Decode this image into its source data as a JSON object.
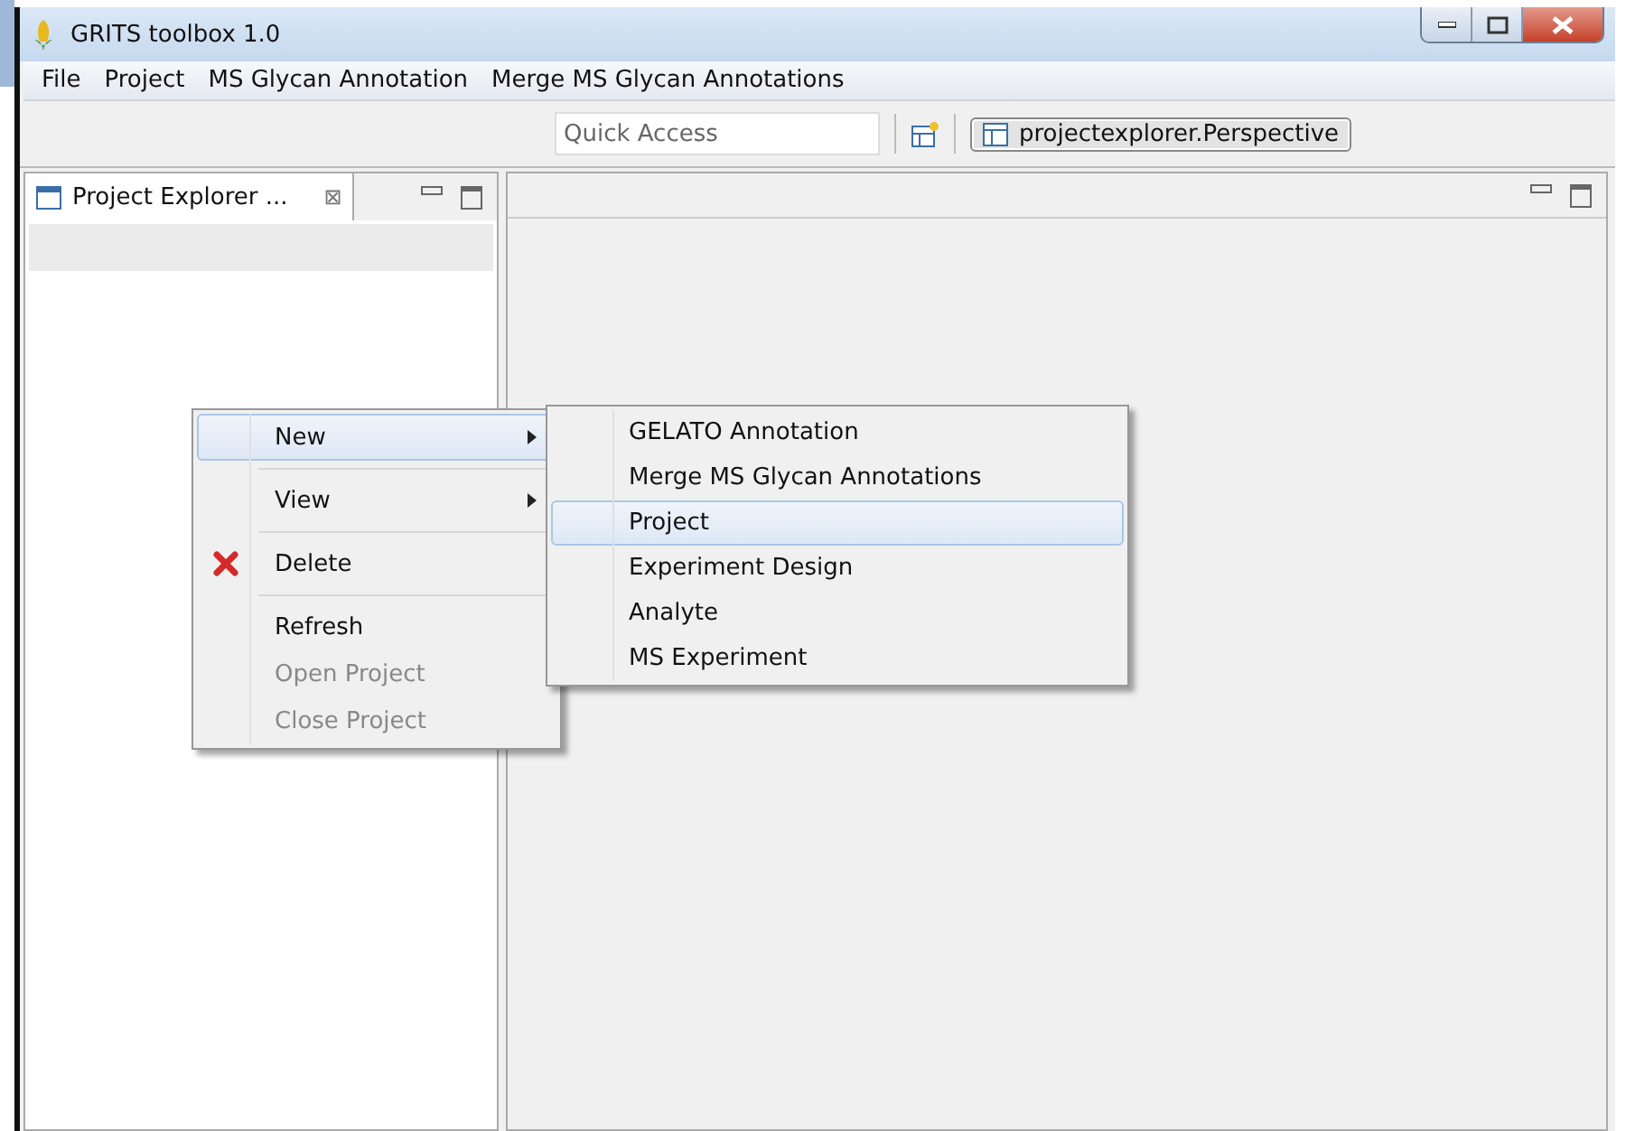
{
  "window": {
    "title": "GRITS toolbox 1.0"
  },
  "menu_bar": [
    "File",
    "Project",
    "MS Glycan Annotation",
    "Merge MS Glycan Annotations"
  ],
  "toolbar": {
    "quick_access": {
      "placeholder": "Quick Access"
    },
    "perspective": {
      "label": "projectexplorer.Perspective",
      "selected": true
    }
  },
  "project_explorer": {
    "tab": {
      "label": "Project Explorer ...",
      "close": "⊠"
    }
  },
  "context_menu": {
    "items": [
      {
        "kind": "item",
        "label": "New",
        "submenu": true,
        "selected": true,
        "disabled": false
      },
      {
        "kind": "separator"
      },
      {
        "kind": "item",
        "label": "View",
        "submenu": true,
        "selected": false,
        "disabled": false
      },
      {
        "kind": "separator"
      },
      {
        "kind": "delete",
        "label": "Delete",
        "submenu": false,
        "selected": false,
        "disabled": false
      },
      {
        "kind": "separator"
      },
      {
        "kind": "item",
        "label": "Refresh",
        "submenu": false,
        "selected": false,
        "disabled": false
      },
      {
        "kind": "item",
        "label": "Open Project",
        "submenu": false,
        "selected": false,
        "disabled": true
      },
      {
        "kind": "item",
        "label": "Close Project",
        "submenu": false,
        "selected": false,
        "disabled": true
      }
    ]
  },
  "submenu": {
    "items": [
      {
        "label": "GELATO Annotation",
        "selected": false
      },
      {
        "label": "Merge MS Glycan Annotations",
        "selected": false
      },
      {
        "label": "Project",
        "selected": true
      },
      {
        "label": "Experiment Design",
        "selected": false
      },
      {
        "label": "Analyte",
        "selected": false
      },
      {
        "label": "MS Experiment",
        "selected": false
      }
    ]
  }
}
